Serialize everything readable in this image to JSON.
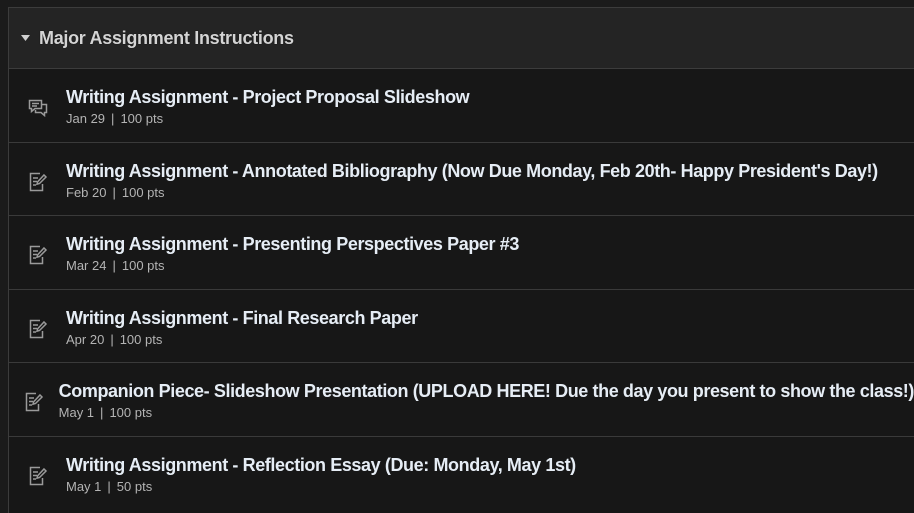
{
  "module": {
    "title": "Major Assignment Instructions",
    "collapse_icon": "triangle-down-icon"
  },
  "items": [
    {
      "icon": "discussion-icon",
      "title": "Writing Assignment - Project Proposal Slideshow",
      "date": "Jan 29",
      "separator": "|",
      "points": "100 pts"
    },
    {
      "icon": "assignment-icon",
      "title": "Writing Assignment - Annotated Bibliography (Now Due Monday, Feb 20th- Happy President's Day!)",
      "date": "Feb 20",
      "separator": "|",
      "points": "100 pts"
    },
    {
      "icon": "assignment-icon",
      "title": "Writing Assignment - Presenting Perspectives Paper #3",
      "date": "Mar 24",
      "separator": "|",
      "points": "100 pts"
    },
    {
      "icon": "assignment-icon",
      "title": "Writing Assignment - Final Research Paper",
      "date": "Apr 20",
      "separator": "|",
      "points": "100 pts"
    },
    {
      "icon": "assignment-icon",
      "title": "Companion Piece- Slideshow Presentation (UPLOAD HERE! Due the day you present to show the class!)",
      "date": "May 1",
      "separator": "|",
      "points": "100 pts"
    },
    {
      "icon": "assignment-icon",
      "title": "Writing Assignment - Reflection Essay (Due: Monday, May 1st)",
      "date": "May 1",
      "separator": "|",
      "points": "50 pts"
    }
  ]
}
